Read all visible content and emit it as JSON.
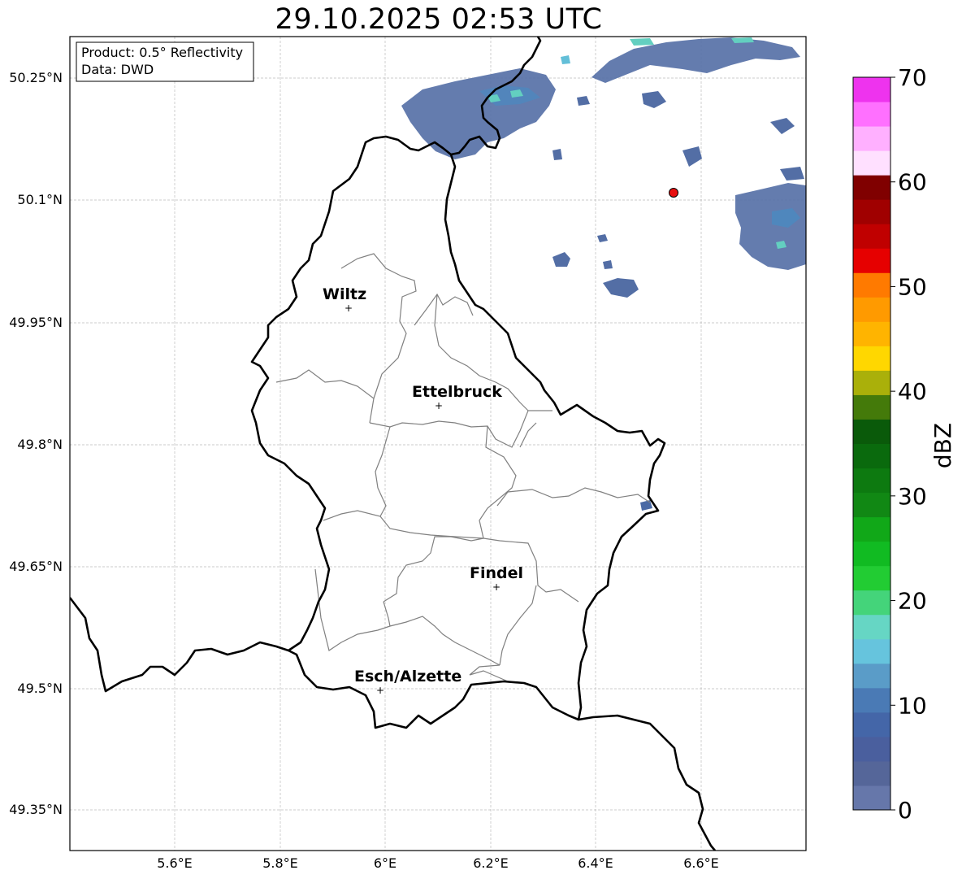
{
  "title": "29.10.2025 02:53 UTC",
  "info_box": {
    "line1": "Product: 0.5° Reflectivity",
    "line2": "Data: DWD"
  },
  "axes": {
    "lat_ticks": [
      "50.25°N",
      "50.1°N",
      "49.95°N",
      "49.8°N",
      "49.65°N",
      "49.5°N",
      "49.35°N"
    ],
    "lon_ticks": [
      "5.6°E",
      "5.8°E",
      "6°E",
      "6.2°E",
      "6.4°E",
      "6.6°E"
    ]
  },
  "cities": [
    {
      "name": "Wiltz"
    },
    {
      "name": "Ettelbruck"
    },
    {
      "name": "Findel"
    },
    {
      "name": "Esch/Alzette"
    }
  ],
  "colorbar": {
    "label": "dBZ",
    "ticks": [
      "0",
      "10",
      "20",
      "30",
      "40",
      "50",
      "60",
      "70"
    ],
    "colors": [
      "#6677aa",
      "#556699",
      "#4a5f9e",
      "#4466a8",
      "#4a7ab5",
      "#5a9cc8",
      "#66c4dd",
      "#66d6c4",
      "#44d47a",
      "#22cc33",
      "#11bb22",
      "#11a818",
      "#118814",
      "#0d7a10",
      "#0a6a0d",
      "#0a5a0a",
      "#447a0a",
      "#aab00a",
      "#ffd700",
      "#ffb400",
      "#ff9a00",
      "#ff7a00",
      "#e60000",
      "#c00000",
      "#a00000",
      "#800000",
      "#ffe0ff",
      "#ffb0ff",
      "#ff70ff",
      "#ee33ee"
    ]
  },
  "colors": {
    "border": "#000000",
    "canton": "#808080",
    "grid": "#bbbbbb",
    "radar_site": "#e81010"
  }
}
